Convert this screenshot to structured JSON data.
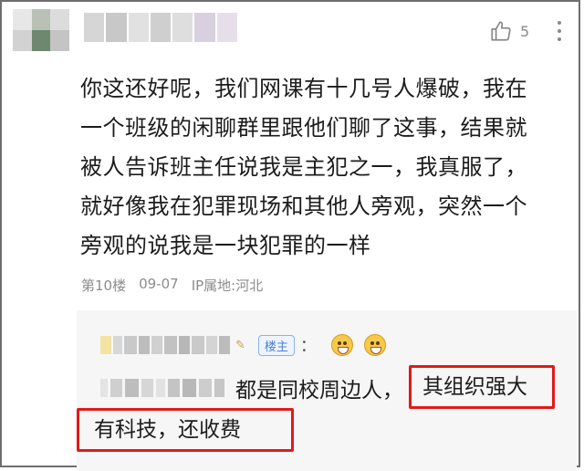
{
  "comment": {
    "like_count": "5",
    "body_lines": [
      "你这还好呢，我们网课有十几号人爆破，我在",
      "一个班级的闲聊群里跟他们聊了这事，结果就",
      "被人告诉班主任说我是主犯之一，我真服了，",
      "就好像我在犯罪现场和其他人旁观，突然一个",
      "旁观的说我是一块犯罪的一样"
    ],
    "floor": "第10楼",
    "date": "09-07",
    "location": "IP属地:河北",
    "icons": {
      "like": "thumbs-up-icon",
      "more": "vertical-dots-icon",
      "star": "star-icon",
      "emoji": "grinning-face-icon"
    }
  },
  "reply": {
    "badge": "楼主",
    "colon": "：",
    "text_part1": "都是同校周边人，",
    "text_highlight": "其组织强大",
    "text_line2": "有科技，还收费",
    "colors": {
      "highlight_border": "#e01a1a",
      "badge": "#4d7fd6"
    }
  }
}
